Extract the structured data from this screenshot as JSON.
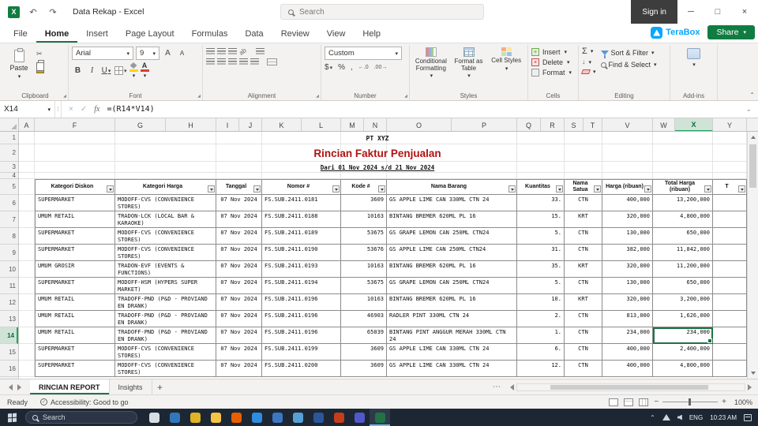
{
  "titlebar": {
    "title": "Data Rekap - Excel",
    "search_placeholder": "Search",
    "sign_in": "Sign in"
  },
  "ribbon": {
    "tabs": [
      "File",
      "Home",
      "Insert",
      "Page Layout",
      "Formulas",
      "Data",
      "Review",
      "View",
      "Help"
    ],
    "active_tab": "Home",
    "terabox_label": "TeraBox",
    "share_label": "Share",
    "clipboard": {
      "label": "Clipboard",
      "paste": "Paste"
    },
    "font": {
      "label": "Font",
      "name": "Arial",
      "size": "9",
      "bold": "B",
      "italic": "I",
      "underline": "U"
    },
    "alignment": {
      "label": "Alignment"
    },
    "number": {
      "label": "Number",
      "format": "Custom",
      "currency": "$",
      "percent": "%",
      "comma": ","
    },
    "styles": {
      "label": "Styles",
      "conditional": "Conditional Formatting",
      "format_table": "Format as Table",
      "cell_styles": "Cell Styles"
    },
    "cells": {
      "label": "Cells",
      "insert": "Insert",
      "delete": "Delete",
      "format": "Format"
    },
    "editing": {
      "label": "Editing",
      "autosum": "Σ",
      "sort": "Sort & Filter",
      "find": "Find & Select"
    },
    "addins": {
      "label": "Add-ins"
    }
  },
  "formula_bar": {
    "name_box": "X14",
    "fx": "fx",
    "formula": "=(R14*V14)"
  },
  "sheet": {
    "columns": [
      "A",
      "F",
      "G",
      "H",
      "I",
      "J",
      "K",
      "L",
      "M",
      "N",
      "O",
      "P",
      "Q",
      "R",
      "S",
      "T",
      "V",
      "W",
      "X",
      "Y"
    ],
    "selected_column": "X",
    "selected_row": "14",
    "row_numbers": [
      "1",
      "2",
      "3",
      "4",
      "5",
      "6",
      "7",
      "8",
      "9",
      "10",
      "11",
      "12",
      "13",
      "14",
      "15",
      "16"
    ],
    "company": "PT XYZ",
    "report_title": "Rincian Faktur Penjualan",
    "period": "Dari 01 Nov 2024 s/d 21 Nov 2024",
    "headers": [
      "Kategori Diskon",
      "Kategori Harga",
      "Tanggal",
      "Nomor #",
      "Kode #",
      "Nama Barang",
      "Kuantitas",
      "Nama Satua",
      "Harga (ribuan)",
      "Total Harga (ribuan)",
      "T"
    ],
    "rows": [
      {
        "row": "6",
        "cells": [
          "SUPERMARKET",
          "MODOFF-CVS (CONVENIENCE STORES)",
          "07 Nov 2024",
          "FS.SUB.2411.0181",
          "3609",
          "GS APPLE LIME CAN 330ML CTN 24",
          "33.",
          "CTN",
          "400,000",
          "13,200,000"
        ]
      },
      {
        "row": "7",
        "cells": [
          "UMUM RETAIL",
          "TRADON-LCK (LOCAL BAR & KARAOKE)",
          "07 Nov 2024",
          "FS.SUB.2411.0188",
          "10163",
          "BINTANG BREMER 620ML PL 16",
          "15.",
          "KRT",
          "320,000",
          "4,800,000"
        ]
      },
      {
        "row": "8",
        "cells": [
          "SUPERMARKET",
          "MODOFF-CVS (CONVENIENCE STORES)",
          "07 Nov 2024",
          "FS.SUB.2411.0189",
          "53675",
          "GS GRAPE LEMON CAN 250ML CTN24",
          "5.",
          "CTN",
          "130,000",
          "650,000"
        ]
      },
      {
        "row": "9",
        "cells": [
          "SUPERMARKET",
          "MODOFF-CVS (CONVENIENCE STORES)",
          "07 Nov 2024",
          "FS.SUB.2411.0190",
          "53676",
          "GS APPLE LIME CAN 250ML CTN24",
          "31.",
          "CTN",
          "382,000",
          "11,842,000"
        ]
      },
      {
        "row": "10",
        "cells": [
          "UMUM GROSIR",
          "TRADON-EVF (EVENTS & FUNCTIONS)",
          "07 Nov 2024",
          "FS.SUB.2411.0193",
          "10163",
          "BINTANG BREMER 620ML PL 16",
          "35.",
          "KRT",
          "320,000",
          "11,200,000"
        ]
      },
      {
        "row": "11",
        "cells": [
          "SUPERMARKET",
          "MODOFF-HSM (HYPERS SUPER MARKET)",
          "07 Nov 2024",
          "FS.SUB.2411.0194",
          "53675",
          "GS GRAPE LEMON CAN 250ML CTN24",
          "5.",
          "CTN",
          "130,000",
          "650,000"
        ]
      },
      {
        "row": "12",
        "cells": [
          "UMUM RETAIL",
          "TRADOFF-PND (P&D - PROVIAND EN DRANK)",
          "07 Nov 2024",
          "FS.SUB.2411.0196",
          "10163",
          "BINTANG BREMER 620ML PL 16",
          "10.",
          "KRT",
          "320,000",
          "3,200,000"
        ]
      },
      {
        "row": "13",
        "cells": [
          "UMUM RETAIL",
          "TRADOFF-PND (P&D - PROVIAND EN DRANK)",
          "07 Nov 2024",
          "FS.SUB.2411.0196",
          "46903",
          "RADLER PINT 330ML CTN 24",
          "2.",
          "CTN",
          "813,000",
          "1,626,000"
        ]
      },
      {
        "row": "14",
        "cells": [
          "UMUM RETAIL",
          "TRADOFF-PND (P&D - PROVIAND EN DRANK)",
          "07 Nov 2024",
          "FS.SUB.2411.0196",
          "65039",
          "BINTANG PINT ANGGUR MERAH 330ML CTN 24",
          "1.",
          "CTN",
          "234,000",
          "234,000"
        ]
      },
      {
        "row": "15",
        "cells": [
          "SUPERMARKET",
          "MODOFF-CVS (CONVENIENCE STORES)",
          "07 Nov 2024",
          "FS.SUB.2411.0199",
          "3609",
          "GS APPLE LIME CAN 330ML CTN 24",
          "6.",
          "CTN",
          "400,000",
          "2,400,000"
        ]
      },
      {
        "row": "16",
        "cells": [
          "SUPERMARKET",
          "MODOFF-CVS (CONVENIENCE STORES)",
          "07 Nov 2024",
          "FS.SUB.2411.0200",
          "3609",
          "GS APPLE LIME CAN 330ML CTN 24",
          "12.",
          "CTN",
          "400,000",
          "4,800,000"
        ]
      }
    ]
  },
  "sheet_tabs": {
    "tabs": [
      "RINCIAN REPORT",
      "Insights"
    ],
    "active": "RINCIAN REPORT"
  },
  "status_bar": {
    "mode": "Ready",
    "accessibility": "Accessibility: Good to go",
    "zoom": "100%"
  },
  "taskbar": {
    "search_placeholder": "Search",
    "language": "ENG",
    "time": "10:23 AM",
    "icons": [
      {
        "name": "task-view-icon",
        "color": "#d7dde4"
      },
      {
        "name": "edge-icon",
        "color": "#3277bc"
      },
      {
        "name": "chrome-icon",
        "color": "#e0b226"
      },
      {
        "name": "file-explorer-icon",
        "color": "#f6c445"
      },
      {
        "name": "firefox-icon",
        "color": "#e66000"
      },
      {
        "name": "store-icon",
        "color": "#2f8ce0"
      },
      {
        "name": "mail-icon",
        "color": "#3b78c3"
      },
      {
        "name": "photos-icon",
        "color": "#56a0d6"
      },
      {
        "name": "word-icon",
        "color": "#2b579a"
      },
      {
        "name": "powerpoint-icon",
        "color": "#c43e1c"
      },
      {
        "name": "teams-icon",
        "color": "#5059c9"
      },
      {
        "name": "excel-icon",
        "color": "#217346",
        "active": true
      }
    ]
  }
}
